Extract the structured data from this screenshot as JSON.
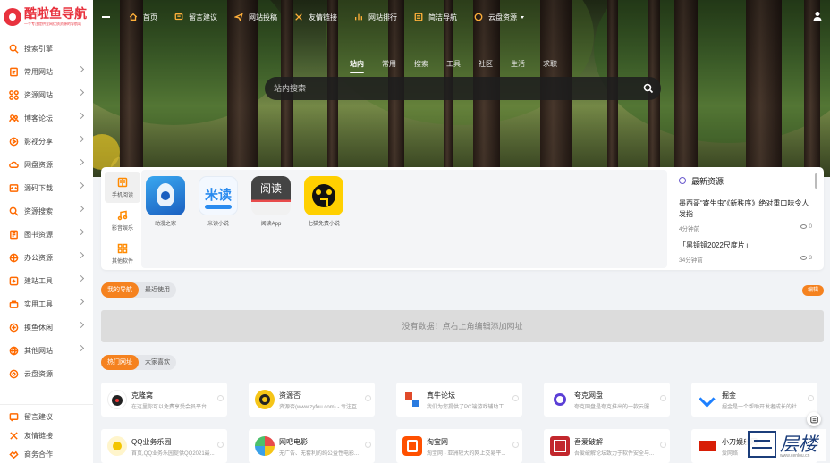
{
  "brand": {
    "title": "酷啦鱼导航",
    "subtitle": "一个专注提供全网优质资源的导航站",
    "accent": "#f5821f"
  },
  "sidebar": {
    "items": [
      {
        "label": "搜索引擎",
        "icon": "search-icon"
      },
      {
        "label": "常用网站",
        "icon": "bookmark-icon"
      },
      {
        "label": "资源网站",
        "icon": "grid-icon"
      },
      {
        "label": "博客论坛",
        "icon": "users-icon"
      },
      {
        "label": "影视分享",
        "icon": "film-icon"
      },
      {
        "label": "网盘资源",
        "icon": "cloud-icon"
      },
      {
        "label": "源码下载",
        "icon": "code-icon"
      },
      {
        "label": "资源搜索",
        "icon": "search-icon"
      },
      {
        "label": "图书资源",
        "icon": "book-icon"
      },
      {
        "label": "办公资源",
        "icon": "briefcase-icon"
      },
      {
        "label": "建站工具",
        "icon": "tools-icon"
      },
      {
        "label": "实用工具",
        "icon": "toolbox-icon"
      },
      {
        "label": "摸鱼休闲",
        "icon": "game-icon"
      },
      {
        "label": "其他网站",
        "icon": "globe-icon"
      },
      {
        "label": "云盘资源",
        "icon": "disk-icon"
      }
    ],
    "footer_items": [
      {
        "label": "留言建议",
        "icon": "message-icon"
      },
      {
        "label": "友情链接",
        "icon": "link-icon"
      },
      {
        "label": "商务合作",
        "icon": "handshake-icon"
      }
    ]
  },
  "topnav": {
    "items": [
      {
        "label": "首页",
        "icon": "home-icon"
      },
      {
        "label": "留言建议",
        "icon": "message-icon"
      },
      {
        "label": "网站投稿",
        "icon": "send-icon"
      },
      {
        "label": "友情链接",
        "icon": "link-icon"
      },
      {
        "label": "网站排行",
        "icon": "chart-icon"
      },
      {
        "label": "简洁导航",
        "icon": "list-icon"
      },
      {
        "label": "云盘资源",
        "icon": "disk-icon"
      }
    ]
  },
  "search": {
    "tabs": [
      "站内",
      "常用",
      "搜索",
      "工具",
      "社区",
      "生活",
      "求职"
    ],
    "active_tab": "站内",
    "placeholder": "站内搜索"
  },
  "apps": {
    "categories": [
      {
        "label": "手机阅读",
        "icon": "book-open-icon"
      },
      {
        "label": "影音娱乐",
        "icon": "music-icon"
      },
      {
        "label": "其他软件",
        "icon": "apps-icon"
      }
    ],
    "active_category": "手机阅读",
    "items": [
      {
        "name": "动漫之家",
        "icon": "dongman-icon",
        "color": "#2e8de0"
      },
      {
        "name": "米读小说",
        "icon": "midu-icon",
        "text": "米读",
        "color": "#2a8bef"
      },
      {
        "name": "阅读App",
        "icon": "yuedu-icon",
        "text": "阅读",
        "color": "#3a3a3a"
      },
      {
        "name": "七猫免费小说",
        "icon": "qimao-icon",
        "color": "#ffd000"
      }
    ]
  },
  "news": {
    "title": "最新资源",
    "items": [
      {
        "title": "墨西哥“寄生虫”《新秩序》绝对重口味令人发指",
        "time": "4分钟前",
        "views": "0"
      },
      {
        "title": "「黑镜镜2022尺度片」",
        "time": "34分钟前",
        "views": "3"
      }
    ]
  },
  "my_nav": {
    "tabs": [
      "我的导航",
      "最近使用"
    ],
    "active": "我的导航",
    "edit_label": "编辑",
    "empty_text": "没有数据！点右上角编辑添加网址"
  },
  "hot": {
    "tabs": [
      "热门网址",
      "大家喜欢"
    ],
    "active": "热门网址",
    "sites": [
      {
        "title": "克隆窝",
        "desc": "在这里你可以免费享受会员平台...",
        "color": "#222222"
      },
      {
        "title": "资源否",
        "desc": "资源否(www.zyfou.com) - 专注互...",
        "color": "#f5c518"
      },
      {
        "title": "真牛论坛",
        "desc": "我们为您提供了PC端游戏辅助工...",
        "color": "#e04a2a"
      },
      {
        "title": "夸克网盘",
        "desc": "夸克网盘是夸克推出的一款云服...",
        "color": "#5b3fd6"
      },
      {
        "title": "掘金",
        "desc": "掘金是一个帮助开发者成长的社...",
        "color": "#1e80ff"
      },
      {
        "title": "QQ业务乐园",
        "desc": "首页,QQ业务乐园提供QQ2021最...",
        "color": "#f3c500"
      },
      {
        "title": "网吧电影",
        "desc": "无广告、无套利的纯公益性电影...",
        "color": "#3aa0e8"
      },
      {
        "title": "淘宝网",
        "desc": "淘宝网 - 亚洲较大的网上交易平...",
        "color": "#ff5000"
      },
      {
        "title": "吾爱破解",
        "desc": "吾爱破解论坛致力于软件安全与...",
        "color": "#c2272d"
      },
      {
        "title": "小刀娱乐网",
        "desc": "爱网络",
        "color": "#d81e06"
      }
    ]
  },
  "watermark": {
    "text": "层楼",
    "sub": "www.cenlou.cn"
  }
}
